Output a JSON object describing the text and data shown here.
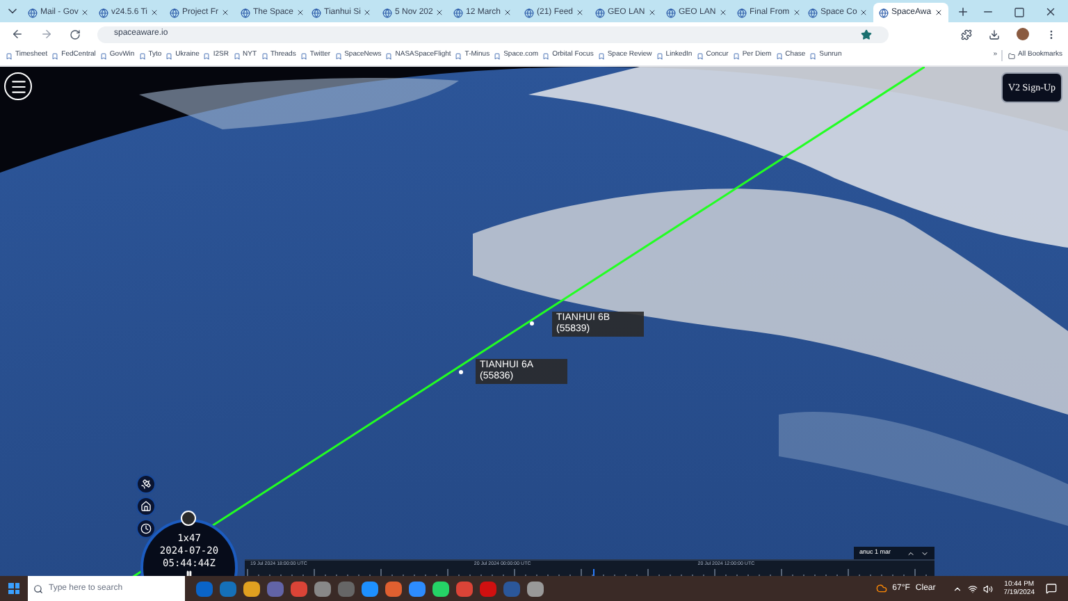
{
  "browser": {
    "tabs": [
      {
        "title": "Mail - Gov",
        "selected": false
      },
      {
        "title": "v24.5.6 Ti",
        "selected": false
      },
      {
        "title": "Project Fr",
        "selected": false
      },
      {
        "title": "The Space",
        "selected": false
      },
      {
        "title": "Tianhui Si",
        "selected": false
      },
      {
        "title": "5 Nov 202",
        "selected": false
      },
      {
        "title": "12 March",
        "selected": false
      },
      {
        "title": "(21) Feed",
        "selected": false
      },
      {
        "title": "GEO LAN",
        "selected": false
      },
      {
        "title": "GEO LAN",
        "selected": false
      },
      {
        "title": "Final From",
        "selected": false
      },
      {
        "title": "Space Co",
        "selected": false
      },
      {
        "title": "SpaceAwa",
        "selected": true
      }
    ],
    "address": "spaceaware.io",
    "bookmarks": [
      "Timesheet",
      "FedCentral",
      "GovWin",
      "Tyto",
      "Ukraine",
      "I2SR",
      "NYT",
      "Threads",
      "Twitter",
      "SpaceNews",
      "NASASpaceFlight",
      "T-Minus",
      "Space.com",
      "Orbital Focus",
      "Space Review",
      "LinkedIn",
      "Concur",
      "Per Diem",
      "Chase",
      "Sunrun"
    ],
    "more": "»",
    "all_bookmarks": "All Bookmarks"
  },
  "scene": {
    "sign_up": "V2 Sign-Up",
    "satellites": [
      {
        "name": "TIANHUI 6B",
        "id": "(55839)"
      },
      {
        "name": "TIANHUI 6A",
        "id": "(55836)"
      }
    ],
    "clock": {
      "speed": "1x47",
      "date": "2024-07-20",
      "time": "05:44:44Z"
    },
    "timeline": {
      "labels": [
        "19 Jul 2024 18:00:00 UTC",
        "20 Jul 2024 00:00:00 UTC",
        "20 Jul 2024 12:00:00 UTC"
      ],
      "scale": "anuc 1 mar"
    }
  },
  "taskbar": {
    "search_placeholder": "Type here to search",
    "temperature": "67°F",
    "condition": "Clear",
    "time": "10:44 PM",
    "date": "7/19/2024"
  }
}
